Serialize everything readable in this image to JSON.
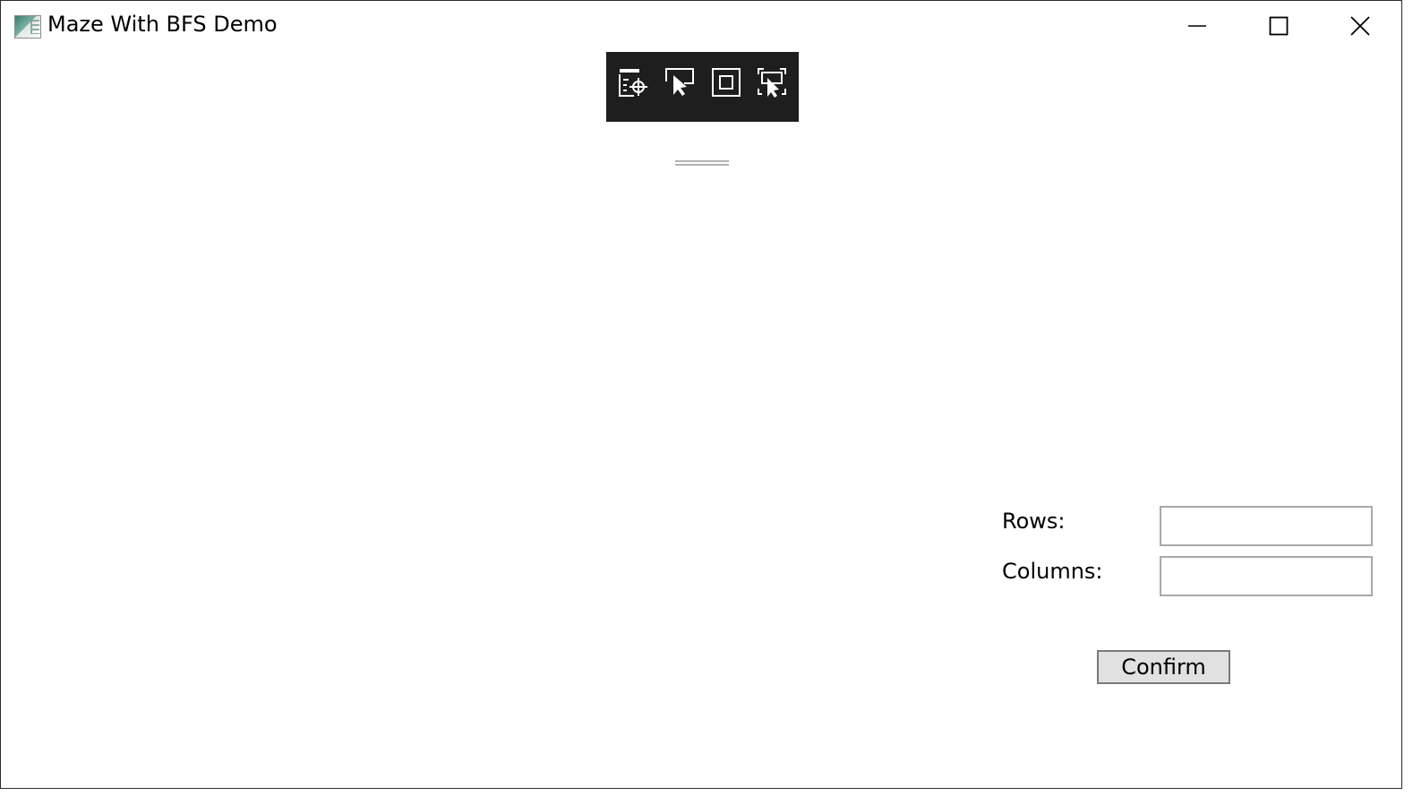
{
  "window": {
    "title": "Maze With BFS Demo",
    "icon": "app-window-icon",
    "controls": {
      "minimize": "minimize-icon",
      "maximize": "maximize-icon",
      "close": "close-icon"
    }
  },
  "debug_toolbar": {
    "buttons": [
      {
        "name": "go-to-live-visual-tree-icon"
      },
      {
        "name": "select-element-icon"
      },
      {
        "name": "display-layout-adorners-icon"
      },
      {
        "name": "track-focused-element-icon"
      }
    ],
    "background": "#1e1e1e"
  },
  "form": {
    "rows_label": "Rows:",
    "rows_value": "",
    "columns_label": "Columns:",
    "columns_value": "",
    "confirm_label": "Confirm"
  },
  "colors": {
    "button_bg": "#e1e1e1",
    "input_border": "#a9a9a9"
  }
}
